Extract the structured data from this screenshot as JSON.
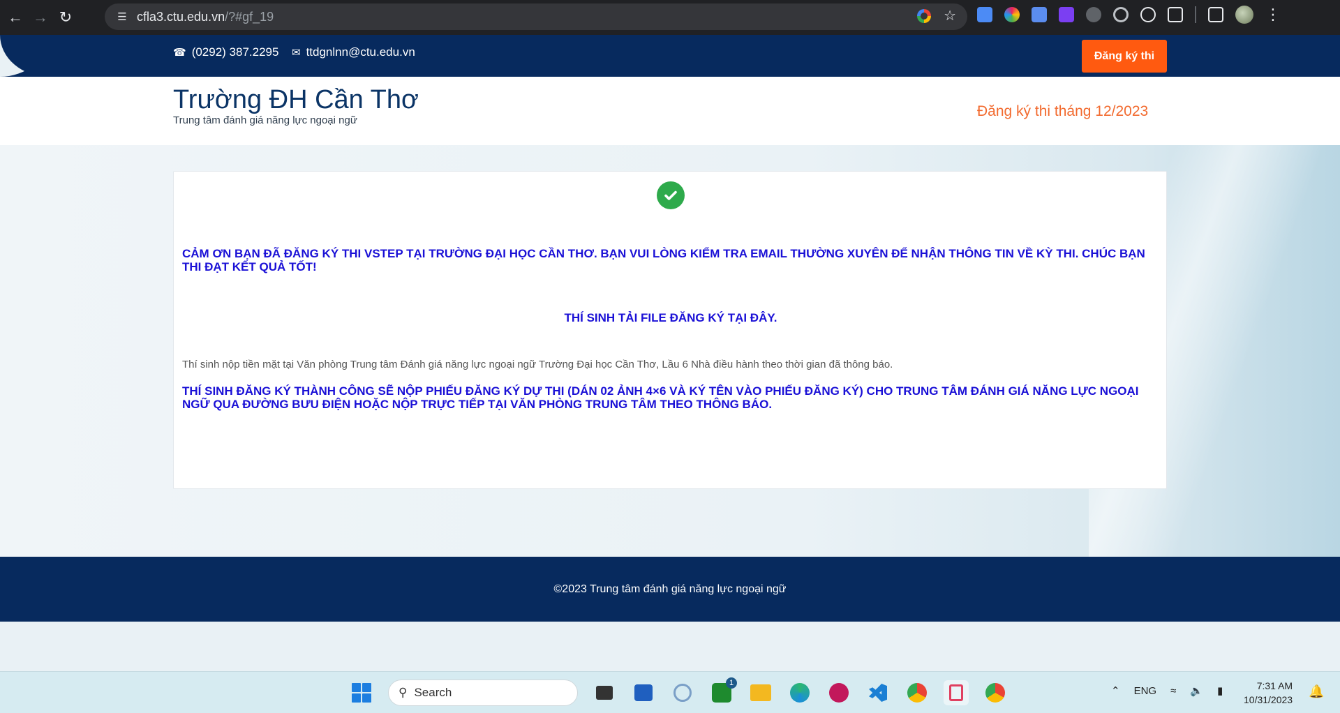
{
  "browser": {
    "url_host": "cfla3.ctu.edu.vn",
    "url_path": "/?#gf_19"
  },
  "topbar": {
    "phone": "(0292) 387.2295",
    "email": "ttdgnlnn@ctu.edu.vn",
    "register_button": "Đăng ký thi"
  },
  "header": {
    "title": "Trường ĐH Cần Thơ",
    "subtitle": "Trung tâm đánh giá năng lực ngoại ngữ",
    "right_link": "Đăng ký thi tháng 12/2023"
  },
  "card": {
    "thanks_message": "Cảm ơn bạn đã đăng ký thi VSTEP tại Trường Đại học Cần Thơ. Bạn vui lòng kiểm tra email thường xuyên để nhận thông tin về kỳ thi. Chúc bạn thi đạt kết quả tốt!",
    "download_link": "Thí sinh tải file đăng ký tại đây.",
    "payment_note": "Thí sinh nộp tiền mặt tại Văn phòng Trung tâm Đánh giá năng lực ngoại ngữ Trường Đại học Cần Thơ, Lầu 6 Nhà điều hành theo thời gian đã thông báo.",
    "submit_message": "Thí sinh đăng ký thành công sẽ nộp phiếu đăng ký dự thi (dán 02 ảnh 4×6 và ký tên vào phiếu đăng ký) cho Trung tâm Đánh giá năng lực ngoại ngữ qua đường bưu điện  hoặc nộp trực tiếp tại văn phòng Trung tâm theo thông báo."
  },
  "footer": {
    "copyright": "©2023 Trung tâm đánh giá năng lực ngoại ngữ"
  },
  "taskbar": {
    "search_placeholder": "Search",
    "language": "ENG",
    "time": "7:31 AM",
    "date": "10/31/2023",
    "badge_count": "1"
  },
  "colors": {
    "navy": "#072a5e",
    "accent_orange": "#ff5a10",
    "message_blue": "#1a10d6",
    "success_green": "#2eaa4b"
  }
}
